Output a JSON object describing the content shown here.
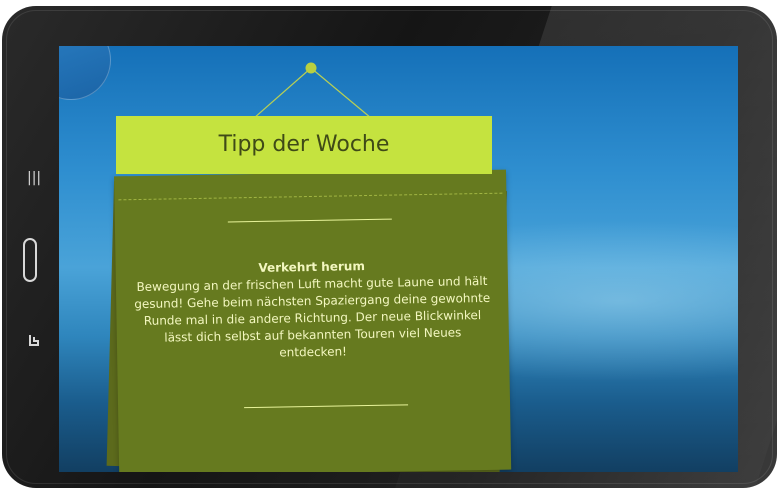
{
  "app": {
    "card_title": "Tipp der Woche",
    "tip_heading": "Verkehrt herum",
    "tip_body": "Bewegung an der frischen Luft macht gute Laune und hält gesund! Gehe beim nächsten Spaziergang deine gewohnte Runde mal in die andere Richtung. Der neue Blickwinkel lässt dich selbst auf bekannten Touren viel Neues entdecken!"
  },
  "colors": {
    "banner": "#c5e33f",
    "note": "#667a1f",
    "screen_top": "#1570b8"
  },
  "icons": {
    "home": "home-icon",
    "nav_recent": "recent-apps-icon",
    "nav_home": "home-button-icon",
    "nav_back": "back-icon"
  }
}
